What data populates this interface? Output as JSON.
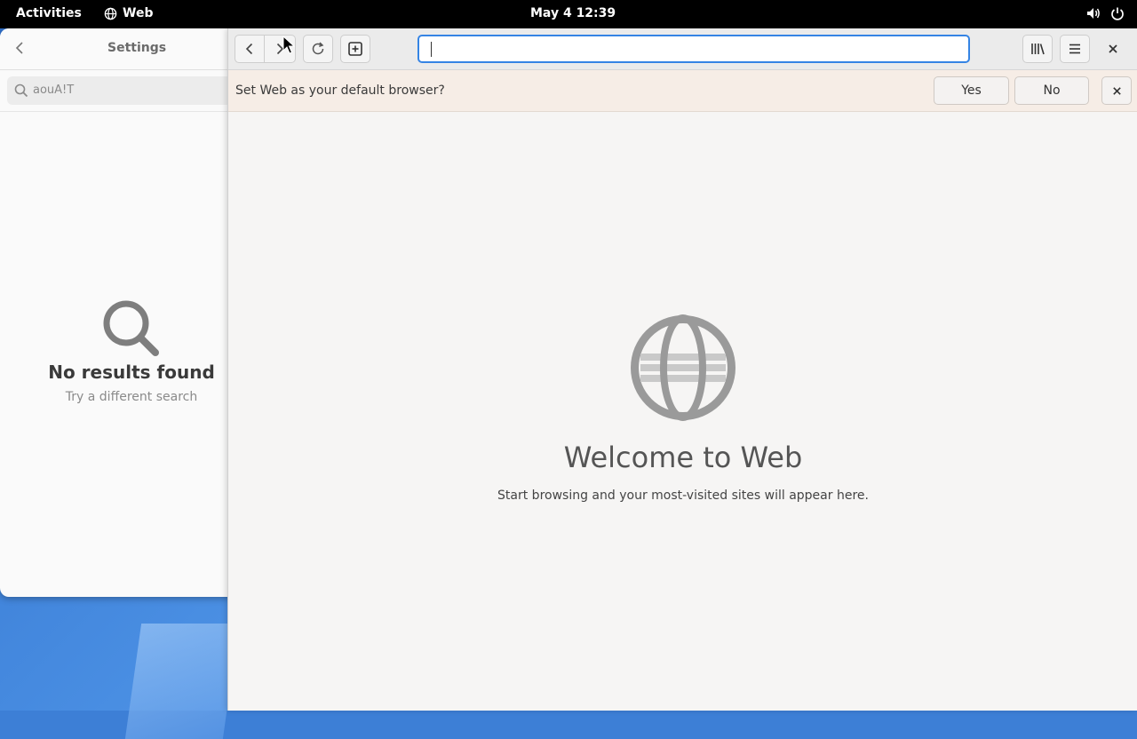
{
  "topbar": {
    "activities": "Activities",
    "app_name": "Web",
    "clock": "May 4  12:39",
    "icons": [
      "globe-icon",
      "volume-icon",
      "power-icon"
    ]
  },
  "settings": {
    "title": "Settings",
    "search_value": "aouA!T",
    "empty_title": "No results found",
    "empty_subtitle": "Try a different search"
  },
  "browser": {
    "url_value": "",
    "infobar": {
      "message": "Set Web as your default browser?",
      "yes": "Yes",
      "no": "No"
    },
    "welcome": {
      "title": "Welcome to Web",
      "subtitle": "Start browsing and your most-visited sites will appear here."
    }
  },
  "colors": {
    "accent": "#3584e4",
    "infobar_bg": "#f6ede6",
    "topbar_bg": "#000000"
  }
}
